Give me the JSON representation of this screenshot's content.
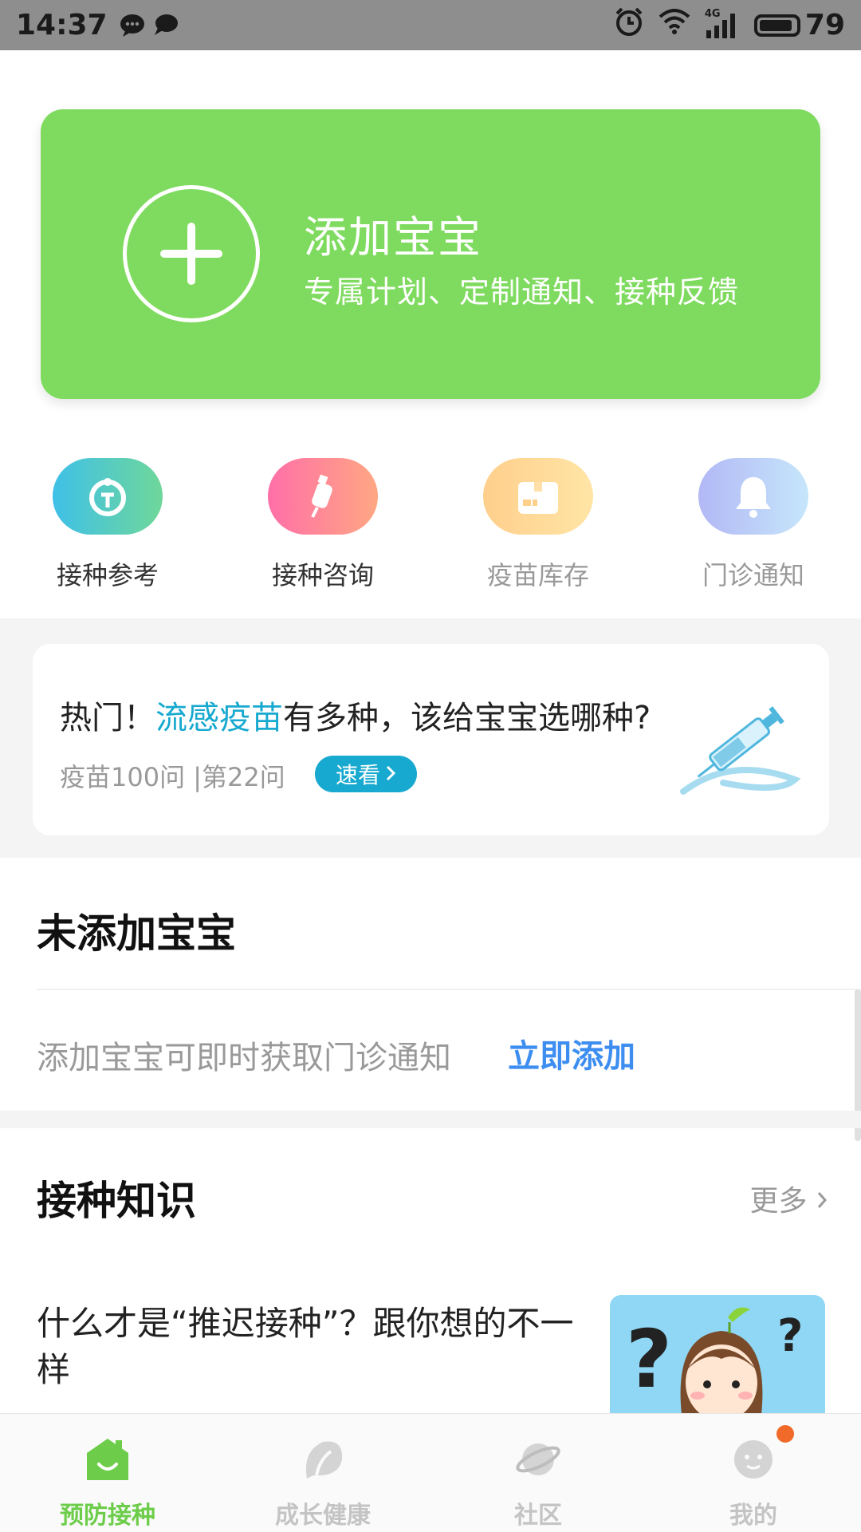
{
  "status_bar": {
    "time": "14:37",
    "network": "4G",
    "battery": "79"
  },
  "add_baby_card": {
    "title": "添加宝宝",
    "subtitle": "专属计划、定制通知、接种反馈"
  },
  "quick_actions": [
    {
      "label": "接种参考",
      "icon": "vaccination-reference-icon",
      "color": "#3fc0e8"
    },
    {
      "label": "接种咨询",
      "icon": "syringe-icon",
      "color": "#ff7aa2"
    },
    {
      "label": "疫苗库存",
      "icon": "box-icon",
      "color": "#ffd08a"
    },
    {
      "label": "门诊通知",
      "icon": "bell-icon",
      "color": "#b6c2f7"
    }
  ],
  "promo_banner": {
    "prefix": "热门！",
    "highlight": "流感疫苗",
    "suffix": "有多种，该给宝宝选哪种?",
    "meta": "疫苗100问 |第22问",
    "button": "速看"
  },
  "no_baby_section": {
    "title": "未添加宝宝",
    "text": "添加宝宝可即时获取门诊通知",
    "action": "立即添加"
  },
  "knowledge_section": {
    "title": "接种知识",
    "more": "更多",
    "articles": [
      {
        "title": "什么才是“推迟接种”？跟你想的不一样"
      }
    ]
  },
  "tab_bar": {
    "tabs": [
      {
        "label": "预防接种",
        "icon": "home-icon",
        "active": true
      },
      {
        "label": "成长健康",
        "icon": "leaf-icon",
        "active": false
      },
      {
        "label": "社区",
        "icon": "planet-icon",
        "active": false
      },
      {
        "label": "我的",
        "icon": "profile-icon",
        "active": false
      }
    ]
  },
  "colors": {
    "accent_green": "#7fdb5f",
    "tab_active": "#6dcd4a",
    "link_blue": "#3d8ef0",
    "highlight_cyan": "#17a9cf",
    "badge_orange": "#f26a2a"
  }
}
